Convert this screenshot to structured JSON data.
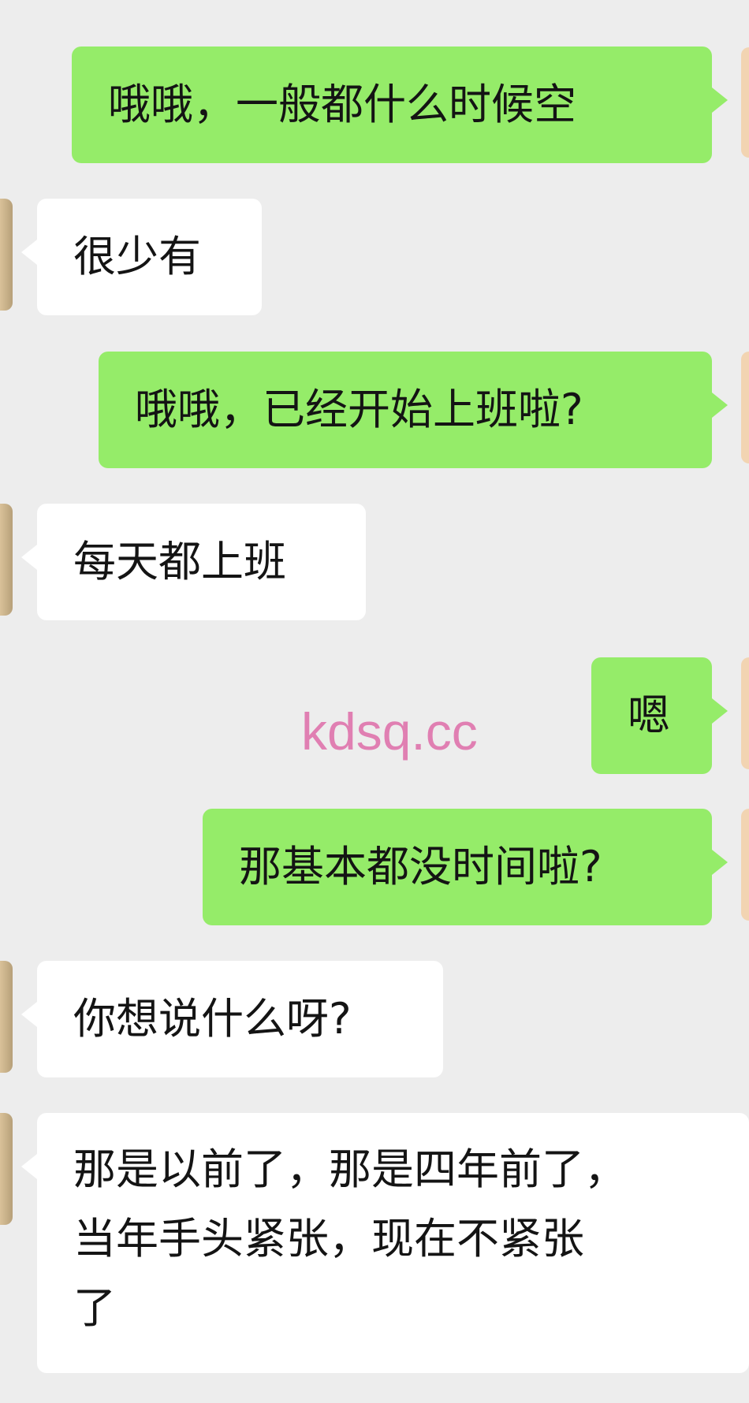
{
  "messages": [
    {
      "side": "sent",
      "text": "哦哦，一般都什么时候空"
    },
    {
      "side": "received",
      "text": "很少有"
    },
    {
      "side": "sent",
      "text": "哦哦，已经开始上班啦?"
    },
    {
      "side": "received",
      "text": "每天都上班"
    },
    {
      "side": "sent",
      "text": "嗯"
    },
    {
      "side": "sent",
      "text": "那基本都没时间啦?"
    },
    {
      "side": "received",
      "text": "你想说什么呀?"
    },
    {
      "side": "received",
      "lines": [
        "那是以前了，那是四年前了，",
        "当年手头紧张，现在不紧张",
        "了"
      ]
    }
  ],
  "watermark": "kdsq.cc",
  "colors": {
    "background": "#ededed",
    "sent_bubble": "#95ec69",
    "received_bubble": "#ffffff",
    "watermark": "#e07fb2"
  }
}
